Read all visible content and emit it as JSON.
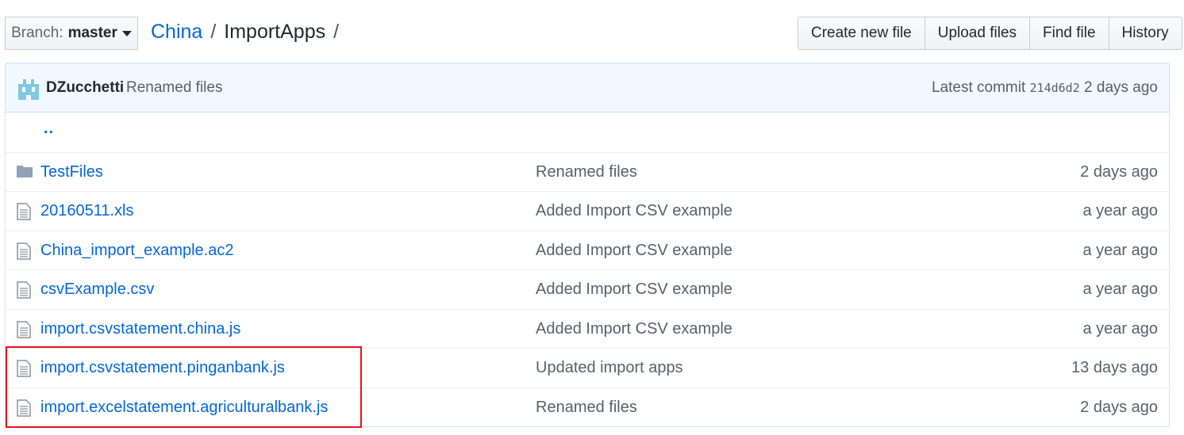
{
  "branch": {
    "label": "Branch:",
    "value": "master"
  },
  "breadcrumb": {
    "root": "China",
    "sep1": "/",
    "current": "ImportApps",
    "sep2": "/"
  },
  "actions": {
    "create": "Create new file",
    "upload": "Upload files",
    "find": "Find file",
    "history": "History"
  },
  "commit": {
    "author": "DZucchetti",
    "message": "Renamed files",
    "prefix": "Latest commit",
    "sha": "214d6d2",
    "age": "2 days ago"
  },
  "files": {
    "parent": "..",
    "rows": [
      {
        "type": "folder",
        "name": "TestFiles",
        "message": "Renamed files",
        "age": "2 days ago"
      },
      {
        "type": "file",
        "name": "20160511.xls",
        "message": "Added Import CSV example",
        "age": "a year ago"
      },
      {
        "type": "file",
        "name": "China_import_example.ac2",
        "message": "Added Import CSV example",
        "age": "a year ago"
      },
      {
        "type": "file",
        "name": "csvExample.csv",
        "message": "Added Import CSV example",
        "age": "a year ago"
      },
      {
        "type": "file",
        "name": "import.csvstatement.china.js",
        "message": "Added Import CSV example",
        "age": "a year ago"
      },
      {
        "type": "file",
        "name": "import.csvstatement.pinganbank.js",
        "message": "Updated import apps",
        "age": "13 days ago"
      },
      {
        "type": "file",
        "name": "import.excelstatement.agriculturalbank.js",
        "message": "Renamed files",
        "age": "2 days ago"
      }
    ]
  },
  "colors": {
    "link": "#0366d6",
    "highlight": "#e0161d",
    "commit_bg": "#f1f8ff"
  }
}
